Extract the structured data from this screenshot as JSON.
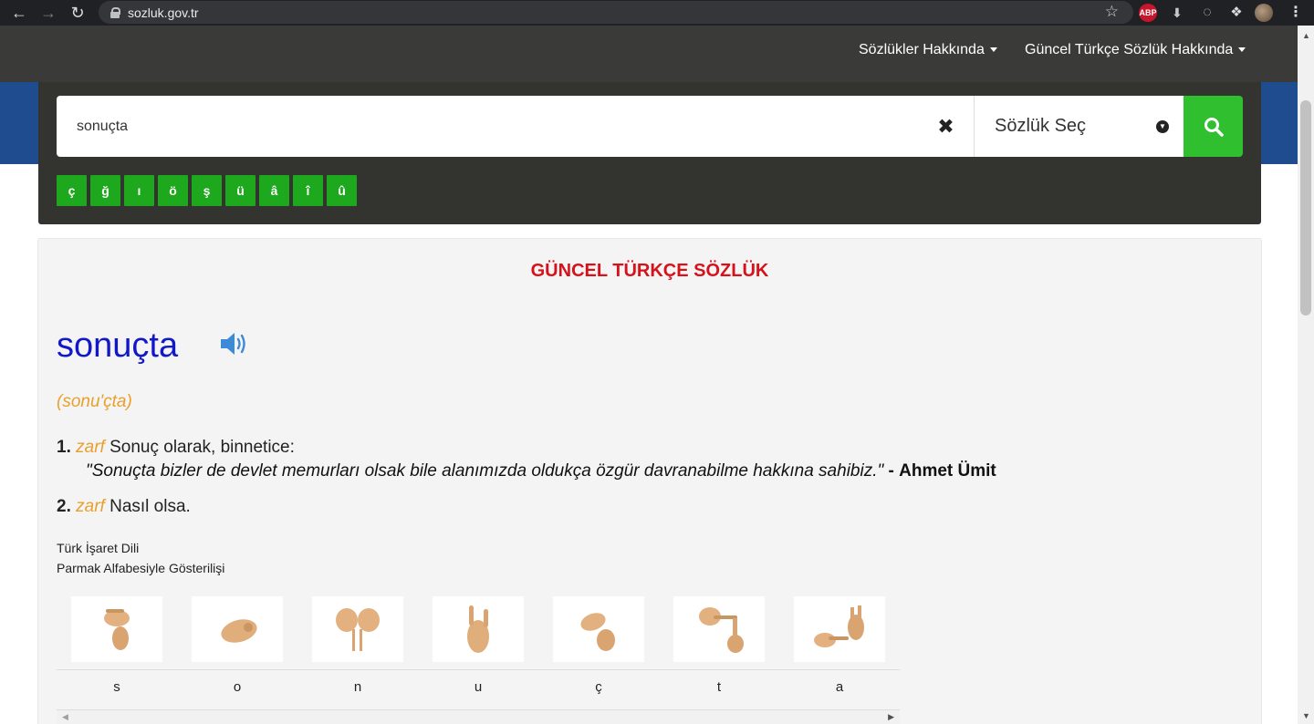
{
  "browser": {
    "url": "sozluk.gov.tr",
    "back_icon": "arrow-left-icon",
    "forward_icon": "arrow-right-icon",
    "reload_icon": "reload-icon",
    "abp_label": "ABP"
  },
  "nav": {
    "items": [
      {
        "label": "Sözlükler Hakkında"
      },
      {
        "label": "Güncel Türkçe Sözlük Hakkında"
      }
    ]
  },
  "search": {
    "value": "sonuçta",
    "dict_select_label": "Sözlük Seç",
    "special_chars": [
      "ç",
      "ğ",
      "ı",
      "ö",
      "ş",
      "ü",
      "â",
      "î",
      "û"
    ]
  },
  "result": {
    "dictionary_title": "GÜNCEL TÜRKÇE SÖZLÜK",
    "headword": "sonuçta",
    "pronunciation": "(sonu'çta)",
    "senses": [
      {
        "number": "1.",
        "pos": "zarf",
        "definition": "Sonuç olarak, binnetice:"
      },
      {
        "number": "2.",
        "pos": "zarf",
        "definition": "Nasıl olsa."
      }
    ],
    "example": {
      "quote": "Sonuçta bizler de devlet memurları olsak bile alanımızda oldukça özgür davranabilme hakkına sahibiz.",
      "author": "Ahmet Ümit"
    },
    "sign_language_title": "Türk İşaret Dili",
    "sign_language_subtitle": "Parmak Alfabesiyle Gösterilişi",
    "letters": [
      "s",
      "o",
      "n",
      "u",
      "ç",
      "t",
      "a"
    ]
  },
  "colors": {
    "accent_green": "#2fbf2f",
    "title_red": "#d5121b",
    "headword_blue": "#1218c8",
    "pos_orange": "#e8a02c"
  }
}
